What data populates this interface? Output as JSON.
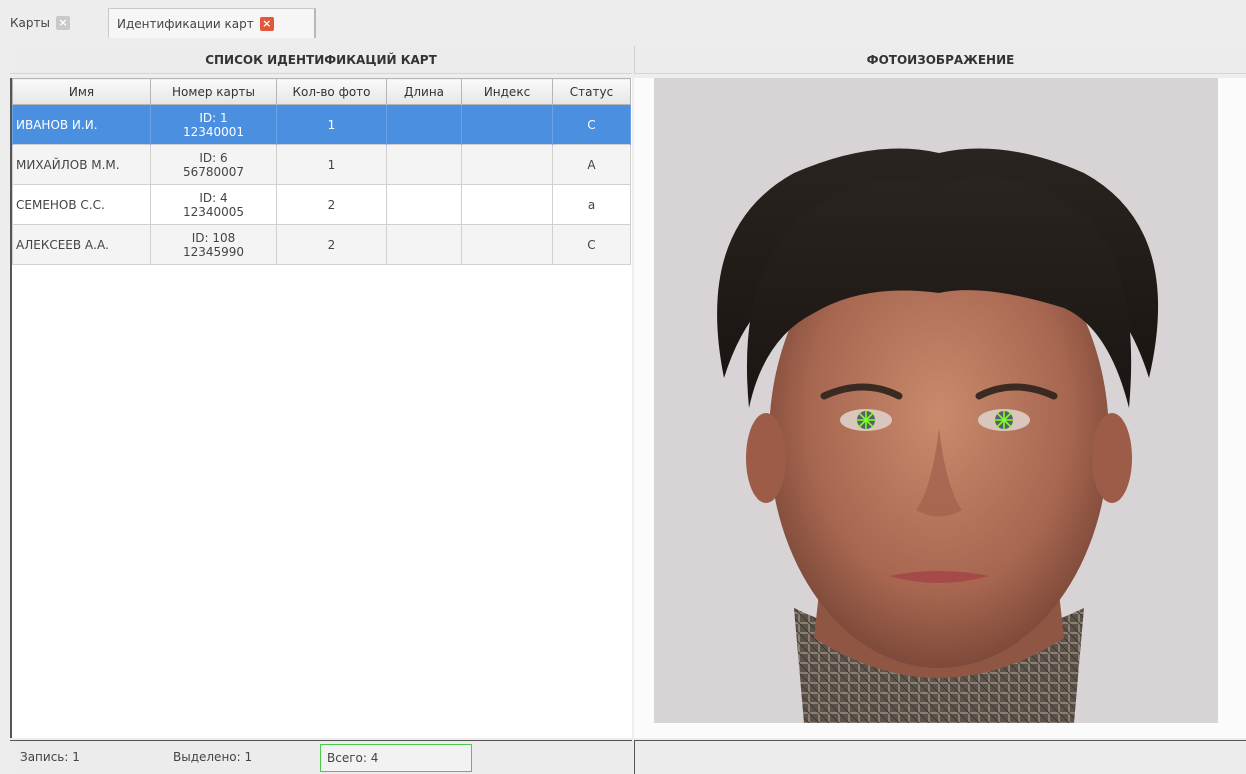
{
  "tabs": [
    {
      "label": "Карты",
      "close": "×"
    },
    {
      "label": "Идентификации карт",
      "close": "×"
    }
  ],
  "left_panel": {
    "title": "СПИСОК ИДЕНТИФИКАЦИЙ КАРТ",
    "columns": [
      "Имя",
      "Номер карты",
      "Кол-во фото",
      "Длина",
      "Индекс",
      "Статус"
    ],
    "rows": [
      {
        "name": "ИВАНОВ И.И.",
        "card_id": "ID: 1",
        "card_number": "12340001",
        "photos": "1",
        "length": "",
        "index": "",
        "status": "C",
        "selected": true
      },
      {
        "name": "МИХАЙЛОВ М.М.",
        "card_id": "ID: 6",
        "card_number": "56780007",
        "photos": "1",
        "length": "",
        "index": "",
        "status": "A",
        "selected": false
      },
      {
        "name": "СЕМЕНОВ С.С.",
        "card_id": "ID: 4",
        "card_number": "12340005",
        "photos": "2",
        "length": "",
        "index": "",
        "status": "a",
        "selected": false
      },
      {
        "name": "АЛЕКСЕЕВ А.А.",
        "card_id": "ID: 108",
        "card_number": "12345990",
        "photos": "2",
        "length": "",
        "index": "",
        "status": "C",
        "selected": false
      }
    ]
  },
  "right_panel": {
    "title": "ФОТОИЗОБРАЖЕНИЕ"
  },
  "statusbar": {
    "record": "Запись: 1",
    "selected": "Выделено: 1",
    "total": "Всего: 4"
  },
  "colors": {
    "selection": "#4a8fe0",
    "tab_close_active": "#e2573b",
    "total_border": "#4ccb4c",
    "eye_marker": "#7dff2a"
  }
}
